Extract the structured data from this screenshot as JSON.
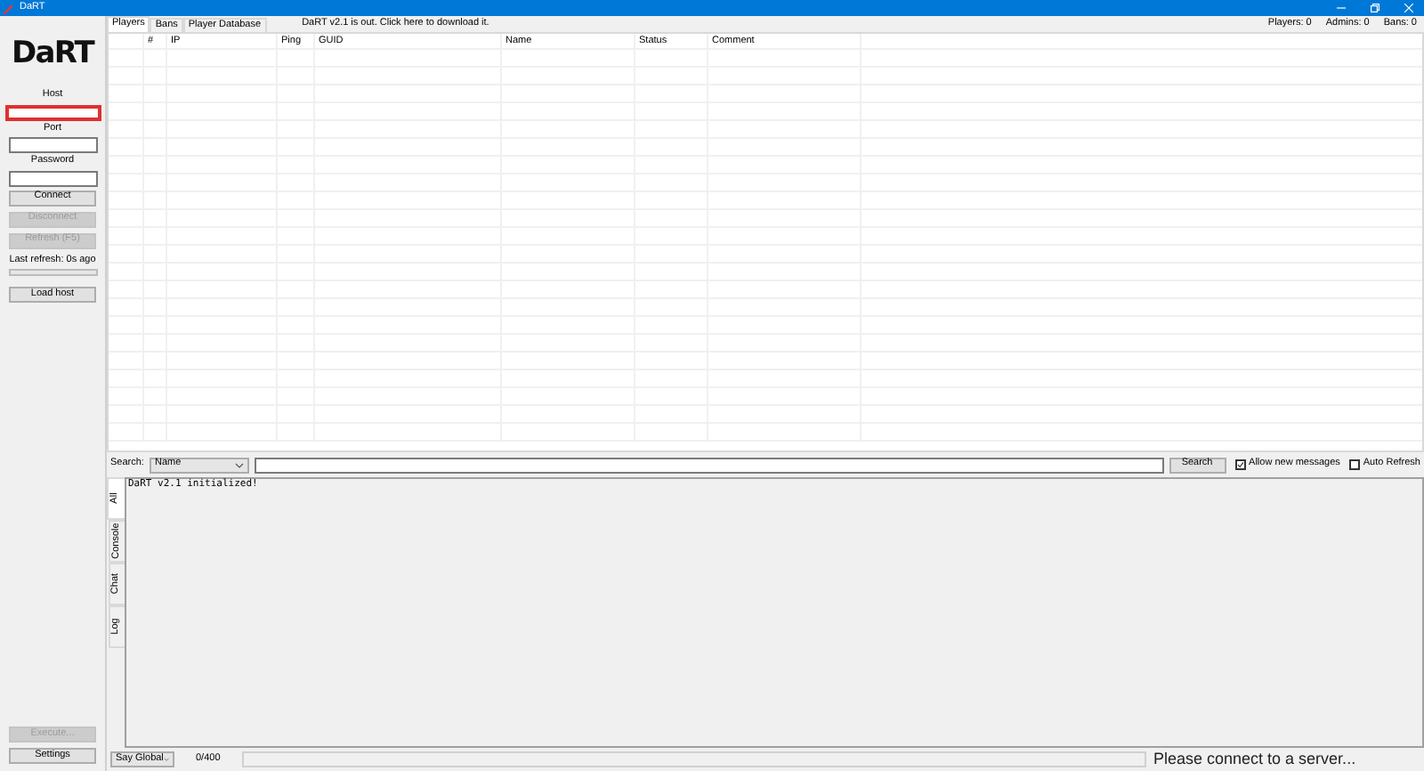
{
  "window": {
    "title": "DaRT"
  },
  "sidebar": {
    "logo": "DaRT",
    "fields": [
      {
        "label": "Host",
        "focused": true
      },
      {
        "label": "Port",
        "focused": false
      },
      {
        "label": "Password",
        "focused": false
      }
    ],
    "buttons": [
      {
        "label": "Connect",
        "disabled": false
      },
      {
        "label": "Disconnect",
        "disabled": true
      },
      {
        "label": "Refresh (F5)",
        "disabled": true
      }
    ],
    "last_refresh": "Last refresh: 0s ago",
    "refresh_progress": {
      "level": 0
    },
    "load_host": {
      "label": "Load host",
      "disabled": false
    },
    "execute": {
      "label": "Execute...",
      "disabled": true
    },
    "settings": {
      "label": "Settings",
      "disabled": false
    }
  },
  "tabs": [
    {
      "label": "Players",
      "selected": true
    },
    {
      "label": "Bans",
      "selected": false
    },
    {
      "label": "Player Database",
      "selected": false
    }
  ],
  "update_notice": "DaRT v2.1 is out. Click here to download it.",
  "counters": [
    "Players: 0",
    "Admins: 0",
    "Bans: 0"
  ],
  "table": {
    "columns": [
      "#",
      "IP",
      "Ping",
      "GUID",
      "Name",
      "Status",
      "Comment"
    ]
  },
  "search": {
    "label": "Search:",
    "filter": "Name",
    "button": "Search",
    "options": [
      {
        "label": "Allow new messages",
        "checked": true
      },
      {
        "label": "Auto Refresh",
        "checked": false
      }
    ]
  },
  "log_tabs": [
    {
      "label": "All",
      "selected": true
    },
    {
      "label": "Console",
      "selected": false
    },
    {
      "label": "Chat",
      "selected": false
    },
    {
      "label": "Log",
      "selected": false
    }
  ],
  "log": [
    "DaRT v2.1 initialized!"
  ],
  "bottom": {
    "say": "Say Global",
    "counter": "0/400",
    "status": "Please connect to a server..."
  }
}
